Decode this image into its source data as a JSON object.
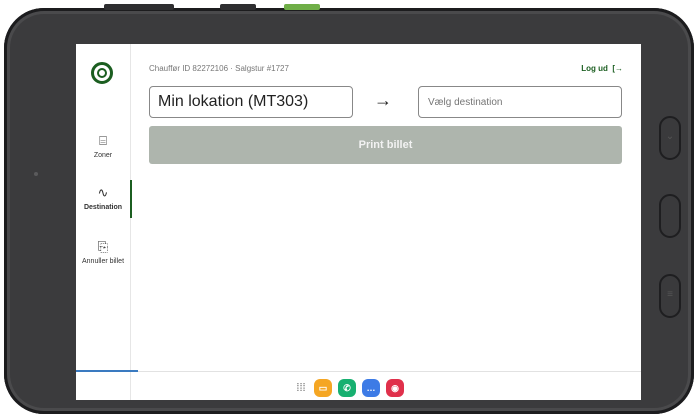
{
  "header": {
    "driver_info": "Chauffør ID 82272106 · Salgstur #1727",
    "logout_label": "Log ud",
    "logout_icon": "logout-icon"
  },
  "sidebar": {
    "items": [
      {
        "label": "Zoner",
        "icon": "ticket-icon",
        "active": false
      },
      {
        "label": "Destination",
        "icon": "route-icon",
        "active": true
      },
      {
        "label": "Annuller billet",
        "icon": "receipt-cancel-icon",
        "active": false
      }
    ]
  },
  "route": {
    "from_value": "Min lokation (MT303)",
    "to_placeholder": "Vælg destination",
    "arrow": "→"
  },
  "print_button": {
    "label": "Print billet",
    "enabled": false
  },
  "colors": {
    "accent": "#1b5e20",
    "disabled_button": "#aeb5ad",
    "bezel": "#3b3b3d"
  },
  "dock": {
    "apps": [
      {
        "icon": "app-drawer-icon"
      },
      {
        "icon": "folder-icon",
        "color": "#f5a623"
      },
      {
        "icon": "phone-icon",
        "color": "#17b070"
      },
      {
        "icon": "messages-icon",
        "color": "#3d7be6"
      },
      {
        "icon": "camera-icon",
        "color": "#e0304b"
      }
    ]
  }
}
